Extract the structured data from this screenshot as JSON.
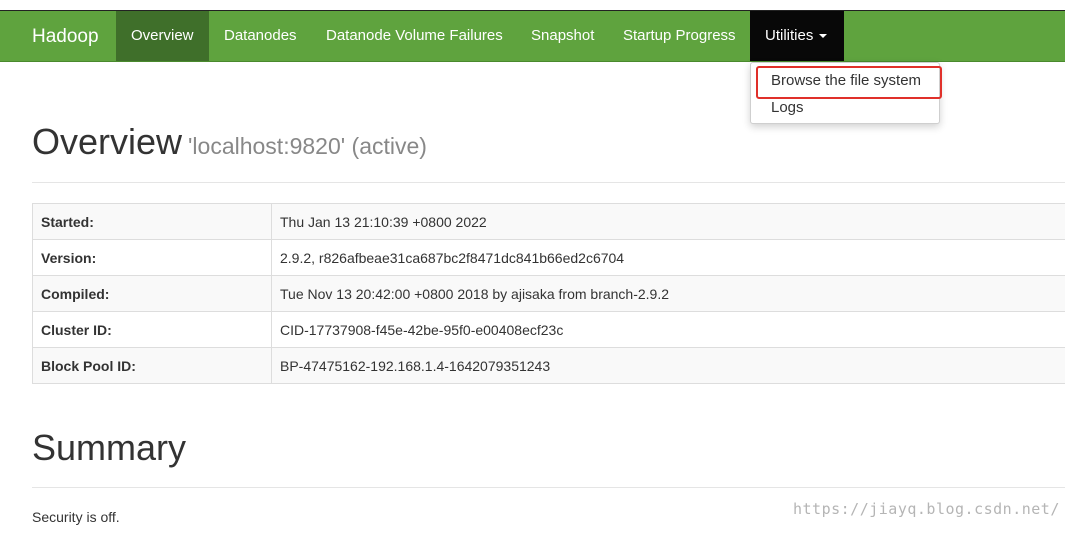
{
  "navbar": {
    "brand": "Hadoop",
    "items": [
      {
        "label": "Overview"
      },
      {
        "label": "Datanodes"
      },
      {
        "label": "Datanode Volume Failures"
      },
      {
        "label": "Snapshot"
      },
      {
        "label": "Startup Progress"
      },
      {
        "label": "Utilities"
      }
    ],
    "active_item": "Overview",
    "brand_color": "#5fa33e",
    "active_color": "#3f6f2a"
  },
  "dropdown": {
    "items": [
      {
        "label": "Browse the file system"
      },
      {
        "label": "Logs"
      }
    ],
    "highlight_color": "#e0302a"
  },
  "overview": {
    "title": "Overview",
    "subtitle": "'localhost:9820' (active)"
  },
  "info_table": {
    "rows": [
      {
        "key": "Started:",
        "value": "Thu Jan 13 21:10:39 +0800 2022"
      },
      {
        "key": "Version:",
        "value": "2.9.2, r826afbeae31ca687bc2f8471dc841b66ed2c6704"
      },
      {
        "key": "Compiled:",
        "value": "Tue Nov 13 20:42:00 +0800 2018 by ajisaka from branch-2.9.2"
      },
      {
        "key": "Cluster ID:",
        "value": "CID-17737908-f45e-42be-95f0-e00408ecf23c"
      },
      {
        "key": "Block Pool ID:",
        "value": "BP-47475162-192.168.1.4-1642079351243"
      }
    ]
  },
  "summary": {
    "title": "Summary",
    "security_text": "Security is off."
  },
  "watermark": "https://jiayq.blog.csdn.net/"
}
